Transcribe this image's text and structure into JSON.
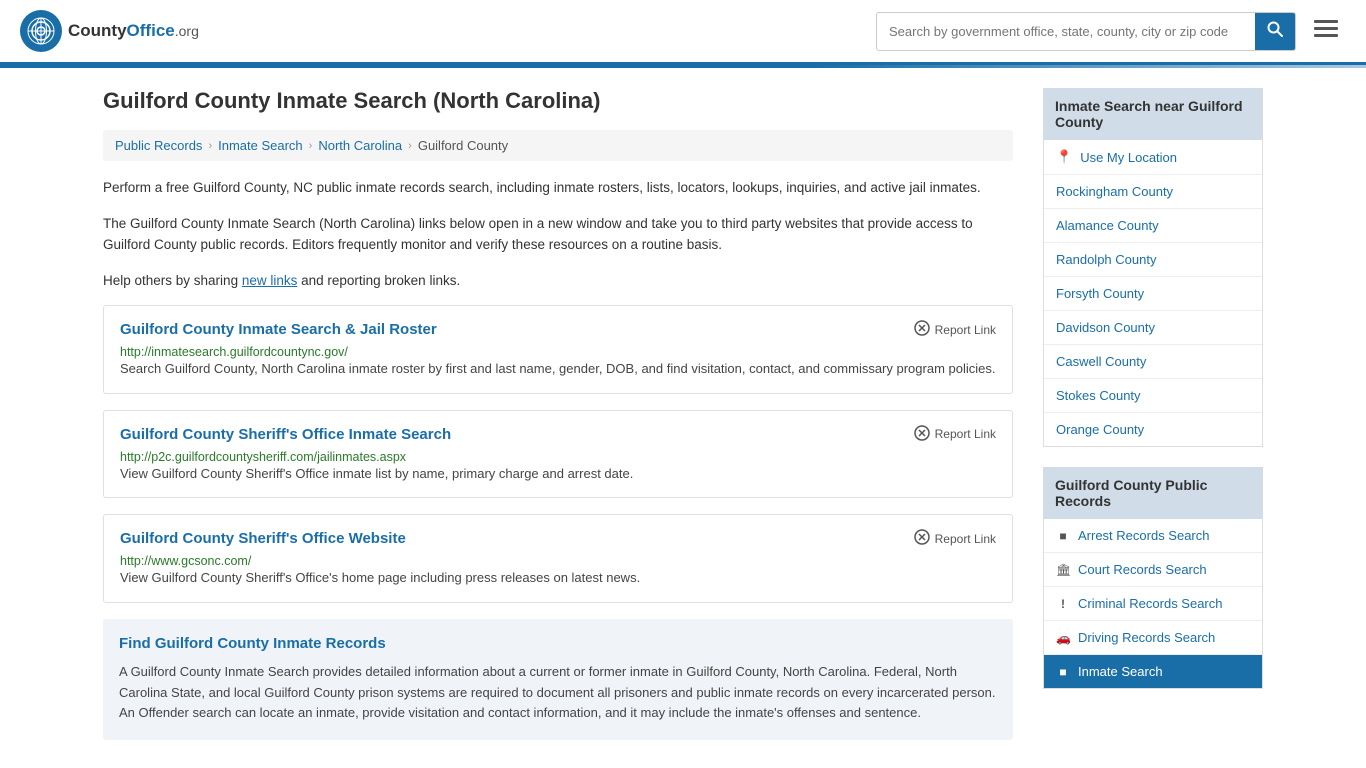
{
  "header": {
    "logo_symbol": "⊕",
    "logo_brand": "CountyOffice",
    "logo_tld": ".org",
    "search_placeholder": "Search by government office, state, county, city or zip code",
    "search_button_icon": "🔍"
  },
  "page": {
    "title": "Guilford County Inmate Search (North Carolina)"
  },
  "breadcrumb": {
    "items": [
      "Public Records",
      "Inmate Search",
      "North Carolina",
      "Guilford County"
    ]
  },
  "description": {
    "para1": "Perform a free Guilford County, NC public inmate records search, including inmate rosters, lists, locators, lookups, inquiries, and active jail inmates.",
    "para2": "The Guilford County Inmate Search (North Carolina) links below open in a new window and take you to third party websites that provide access to Guilford County public records. Editors frequently monitor and verify these resources on a routine basis.",
    "para3_prefix": "Help others by sharing ",
    "para3_link": "new links",
    "para3_suffix": " and reporting broken links."
  },
  "results": [
    {
      "title": "Guilford County Inmate Search & Jail Roster",
      "url": "http://inmatesearch.guilfordcountync.gov/",
      "desc": "Search Guilford County, North Carolina inmate roster by first and last name, gender, DOB, and find visitation, contact, and commissary program policies.",
      "report_label": "Report Link"
    },
    {
      "title": "Guilford County Sheriff's Office Inmate Search",
      "url": "http://p2c.guilfordcountysheriff.com/jailinmates.aspx",
      "desc": "View Guilford County Sheriff's Office inmate list by name, primary charge and arrest date.",
      "report_label": "Report Link"
    },
    {
      "title": "Guilford County Sheriff's Office Website",
      "url": "http://www.gcsonc.com/",
      "desc": "View Guilford County Sheriff's Office's home page including press releases on latest news.",
      "report_label": "Report Link"
    }
  ],
  "find_section": {
    "title": "Find Guilford County Inmate Records",
    "desc": "A Guilford County Inmate Search provides detailed information about a current or former inmate in Guilford County, North Carolina. Federal, North Carolina State, and local Guilford County prison systems are required to document all prisoners and public inmate records on every incarcerated person. An Offender search can locate an inmate, provide visitation and contact information, and it may include the inmate's offenses and sentence."
  },
  "sidebar": {
    "nearby_heading": "Inmate Search near Guilford County",
    "nearby_items": [
      {
        "label": "Use My Location",
        "icon": "location"
      },
      {
        "label": "Rockingham County",
        "icon": ""
      },
      {
        "label": "Alamance County",
        "icon": ""
      },
      {
        "label": "Randolph County",
        "icon": ""
      },
      {
        "label": "Forsyth County",
        "icon": ""
      },
      {
        "label": "Davidson County",
        "icon": ""
      },
      {
        "label": "Caswell County",
        "icon": ""
      },
      {
        "label": "Stokes County",
        "icon": ""
      },
      {
        "label": "Orange County",
        "icon": ""
      }
    ],
    "records_heading": "Guilford County Public Records",
    "records_items": [
      {
        "label": "Arrest Records Search",
        "icon": "■"
      },
      {
        "label": "Court Records Search",
        "icon": "🏛"
      },
      {
        "label": "Criminal Records Search",
        "icon": "!"
      },
      {
        "label": "Driving Records Search",
        "icon": "🚗"
      },
      {
        "label": "Inmate Search",
        "icon": "■"
      }
    ]
  }
}
